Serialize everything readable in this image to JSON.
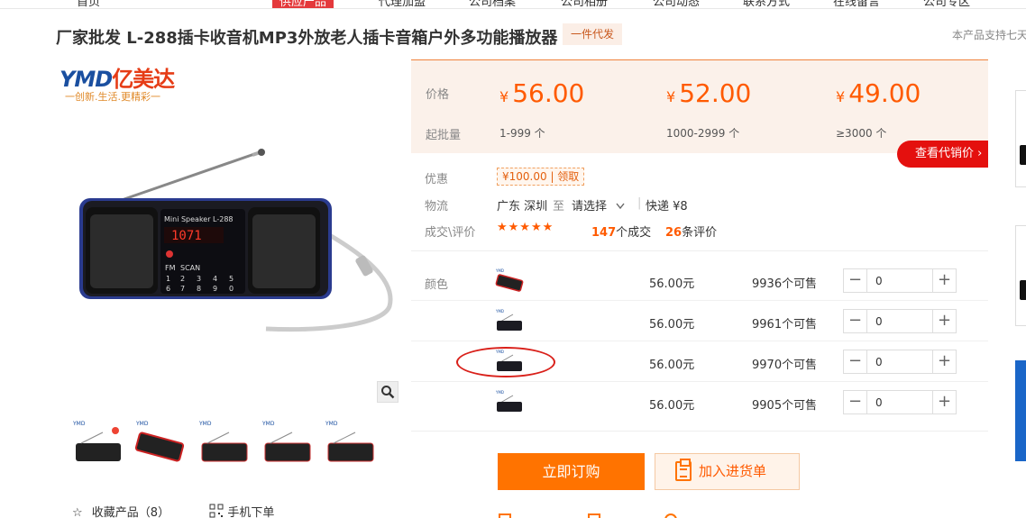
{
  "nav": {
    "items": [
      "首页",
      "供应产品",
      "代理加盟",
      "公司档案",
      "公司相册",
      "公司动态",
      "联系方式",
      "在线留言",
      "公司专区"
    ],
    "active_index": 1
  },
  "product": {
    "title": "厂家批发 L-288插卡收音机MP3外放老人插卡音箱户外多功能播放器",
    "tag": "一件代发",
    "support_text": "本产品支持七天",
    "image_label": "Mini Speaker  L-288",
    "display_digits": "1071"
  },
  "brand": {
    "logo_text": "YMD",
    "logo_cn": "亿美达",
    "slogan": "一创新.生活.更精彩一"
  },
  "price": {
    "price_label": "价格",
    "qty_label": "起批量",
    "currency": "¥",
    "tiers": [
      {
        "price": "56.00",
        "range": "1-999 个"
      },
      {
        "price": "52.00",
        "range": "1000-2999 个"
      },
      {
        "price": "49.00",
        "range": "≥3000 个"
      }
    ],
    "dealer_button": "查看代销价 ›"
  },
  "info": {
    "promo_label": "优惠",
    "coupon_amount": "¥100.00",
    "coupon_action": "领取",
    "shipping_label": "物流",
    "ship_from": "广东 深圳",
    "ship_to_word": "至",
    "ship_select": "请选择",
    "ship_method": "快递 ¥8",
    "deals_label": "成交\\评价",
    "stars": "★★★★★",
    "deal_count": "147",
    "deal_suffix": "个成交",
    "review_count": "26",
    "review_suffix": "条评价"
  },
  "sku": {
    "label": "颜色",
    "rows": [
      {
        "price": "56.00元",
        "stock": "9936个可售",
        "qty": "0"
      },
      {
        "price": "56.00元",
        "stock": "9961个可售",
        "qty": "0"
      },
      {
        "price": "56.00元",
        "stock": "9970个可售",
        "qty": "0"
      },
      {
        "price": "56.00元",
        "stock": "9905个可售",
        "qty": "0"
      }
    ]
  },
  "buttons": {
    "order": "立即订购",
    "cart": "加入进货单"
  },
  "gallery": {
    "favorite": "收藏产品（8）",
    "mobile_order": "手机下单"
  },
  "icons": {
    "zoom": "magnifier-icon",
    "star": "star-outline-icon",
    "qr": "qr-code-icon",
    "cart": "clipboard-icon"
  },
  "colors": {
    "accent": "#ff5a00",
    "order_button": "#ff7300",
    "dealer_button": "#e4100e",
    "price_bg": "#fbf1ea"
  }
}
